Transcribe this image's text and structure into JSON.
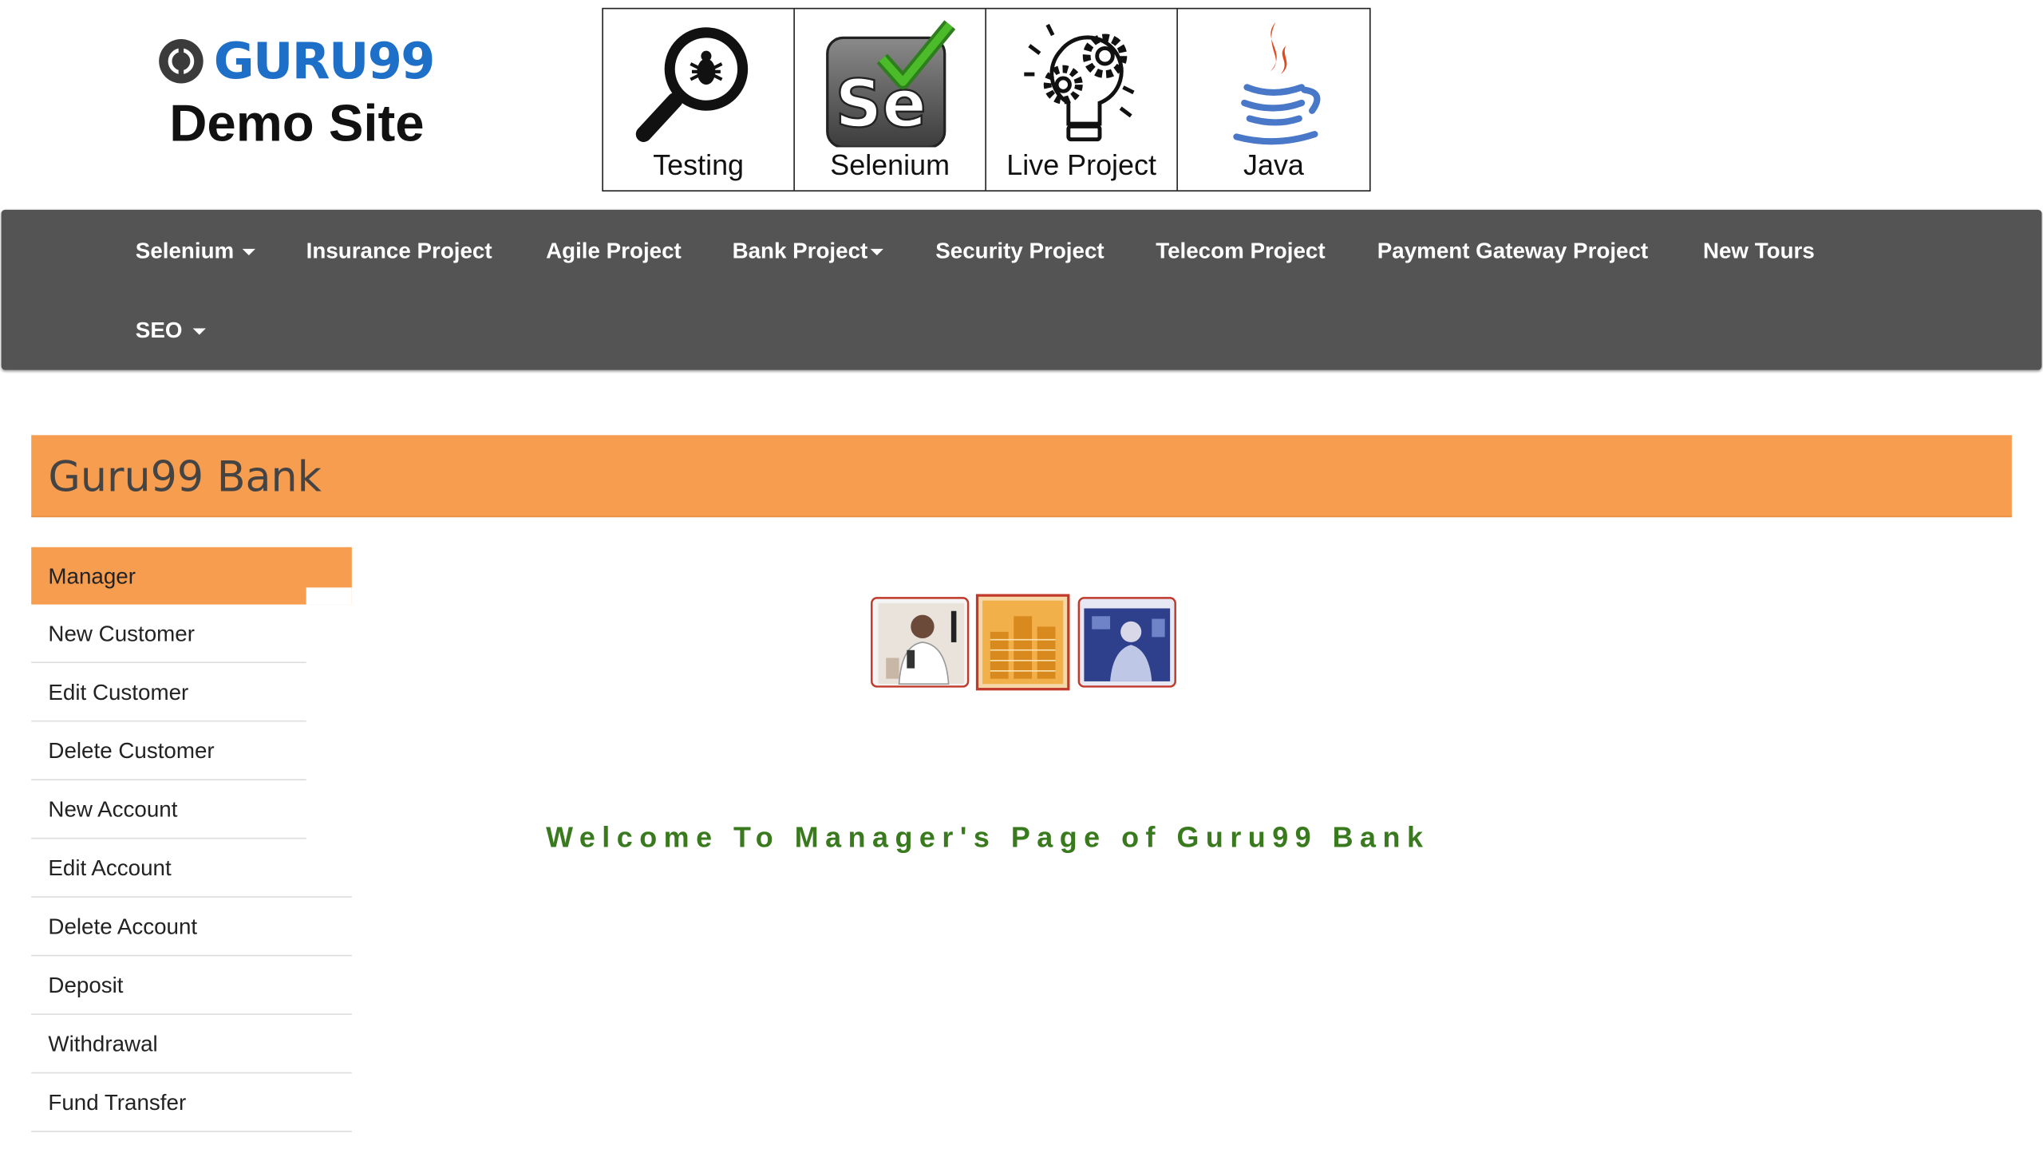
{
  "brand": {
    "logo_text": "GURU99",
    "subtitle": "Demo Site"
  },
  "tiles": [
    {
      "label": "Testing",
      "icon": "magnifier-bug-icon"
    },
    {
      "label": "Selenium",
      "icon": "selenium-check-icon"
    },
    {
      "label": "Live Project",
      "icon": "gear-bulb-icon"
    },
    {
      "label": "Java",
      "icon": "java-cup-icon"
    }
  ],
  "nav": {
    "items": [
      {
        "label": "Selenium",
        "dropdown": true
      },
      {
        "label": "Insurance Project",
        "dropdown": false
      },
      {
        "label": "Agile Project",
        "dropdown": false
      },
      {
        "label": "Bank Project",
        "dropdown": true
      },
      {
        "label": "Security Project",
        "dropdown": false
      },
      {
        "label": "Telecom Project",
        "dropdown": false
      },
      {
        "label": "Payment Gateway Project",
        "dropdown": false
      },
      {
        "label": "New Tours",
        "dropdown": false
      },
      {
        "label": "SEO",
        "dropdown": true
      }
    ]
  },
  "bank": {
    "title": "Guru99 Bank"
  },
  "menu": {
    "header": "Manager",
    "items": [
      "New Customer",
      "Edit Customer",
      "Delete Customer",
      "New Account",
      "Edit Account",
      "Delete Account",
      "Deposit",
      "Withdrawal",
      "Fund Transfer"
    ]
  },
  "main": {
    "welcome": "Welcome To Manager's Page of Guru99 Bank"
  },
  "colors": {
    "accent": "#f79d50",
    "navbar": "#545454",
    "welcome": "#3a7a1e",
    "logo": "#1e6fc8"
  }
}
